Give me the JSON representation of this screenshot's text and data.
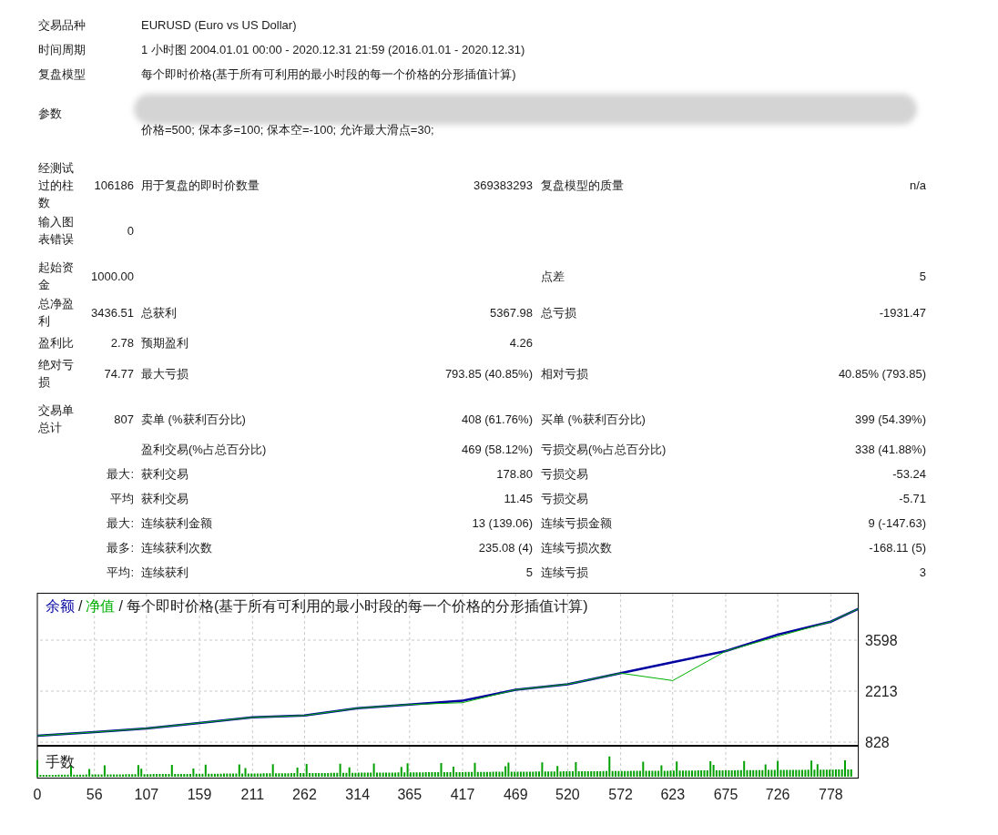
{
  "header": [
    {
      "label": "交易品种",
      "value": "EURUSD (Euro vs US Dollar)"
    },
    {
      "label": "时间周期",
      "value": "1 小时图 2004.01.01 00:00 - 2020.12.31 21:59 (2016.01.01 - 2020.12.31)"
    },
    {
      "label": "复盘模型",
      "value": "每个即时价格(基于所有可利用的最小时段的每一个价格的分形插值计算)"
    }
  ],
  "parameters": {
    "label": "参数",
    "value": "价格=500; 保本多=100; 保本空=-100; 允许最大滑点=30;"
  },
  "stat_groups": [
    [
      {
        "column_1": "经测试过的柱数",
        "column_2": "106186",
        "column_3": "用于复盘的即时价数量",
        "column_4": "369383293",
        "column_5": "复盘模型的质量",
        "column_6": "n/a"
      },
      {
        "column_1": "输入图表错误",
        "column_2": "0"
      }
    ],
    [
      {
        "column_1": "起始资金",
        "column_2": "1000.00",
        "column_5": "点差",
        "column_6": "5"
      },
      {
        "column_1": "总净盈利",
        "column_2": "3436.51",
        "column_3": "总获利",
        "column_4": "5367.98",
        "column_5": "总亏损",
        "column_6": "-1931.47"
      },
      {
        "column_1": "盈利比",
        "column_2": "2.78",
        "column_3": "预期盈利",
        "column_4": "4.26"
      },
      {
        "column_1": "绝对亏损",
        "column_2": "74.77",
        "column_3": "最大亏损",
        "column_4": "793.85 (40.85%)",
        "column_5": "相对亏损",
        "column_6": "40.85% (793.85)"
      }
    ],
    [
      {
        "column_1": "交易单总计",
        "column_2": "807",
        "column_3": "卖单 (%获利百分比)",
        "column_4": "408 (61.76%)",
        "column_5": "买单 (%获利百分比)",
        "column_6": "399 (54.39%)"
      },
      {
        "column_3": "盈利交易(%占总百分比)",
        "column_4": "469 (58.12%)",
        "column_5": "亏损交易(%占总百分比)",
        "column_6": "338 (41.88%)"
      },
      {
        "column_2": "最大:",
        "column_3": "获利交易",
        "column_4": "178.80",
        "column_5": "亏损交易",
        "column_6": "-53.24"
      },
      {
        "column_2": "平均",
        "column_3": "获利交易",
        "column_4": "11.45",
        "column_5": "亏损交易",
        "column_6": "-5.71"
      },
      {
        "column_2": "最大:",
        "column_3": "连续获利金额",
        "column_4": "13 (139.06)",
        "column_5": "连续亏损金额",
        "column_6": "9 (-147.63)"
      },
      {
        "column_2": "最多:",
        "column_3": "连续获利次数",
        "column_4": "235.08 (4)",
        "column_5": "连续亏损次数",
        "column_6": "-168.11 (5)"
      },
      {
        "column_2": "平均:",
        "column_3": "连续获利",
        "column_4": "5",
        "column_5": "连续亏损",
        "column_6": "3"
      }
    ]
  ],
  "chart": {
    "legend_separator": "/",
    "volume_label": "手数",
    "chart_data": {
      "type": "line",
      "title": "每个即时价格(基于所有可利用的最小时段的每一个价格的分形插值计算)",
      "x": [
        0,
        56,
        107,
        159,
        211,
        262,
        314,
        365,
        417,
        469,
        520,
        572,
        623,
        675,
        726,
        778,
        805
      ],
      "xlim": [
        0,
        805
      ],
      "ylim": [
        740,
        4870
      ],
      "grid": true,
      "series": [
        {
          "name": "余额",
          "color": "#0000a0",
          "values": [
            1000,
            1100,
            1200,
            1350,
            1500,
            1550,
            1750,
            1850,
            1950,
            2250,
            2400,
            2700,
            3000,
            3300,
            3750,
            4100,
            4450
          ]
        },
        {
          "name": "净值",
          "color": "#00b000",
          "values": [
            1000,
            1100,
            1200,
            1350,
            1500,
            1550,
            1750,
            1850,
            1900,
            2250,
            2400,
            2700,
            2500,
            3300,
            3700,
            4100,
            4450
          ]
        }
      ],
      "xticks": [
        0,
        56,
        107,
        159,
        211,
        262,
        314,
        365,
        417,
        469,
        520,
        572,
        623,
        675,
        726,
        778
      ],
      "yticks": [
        828,
        2213,
        3598
      ]
    }
  }
}
